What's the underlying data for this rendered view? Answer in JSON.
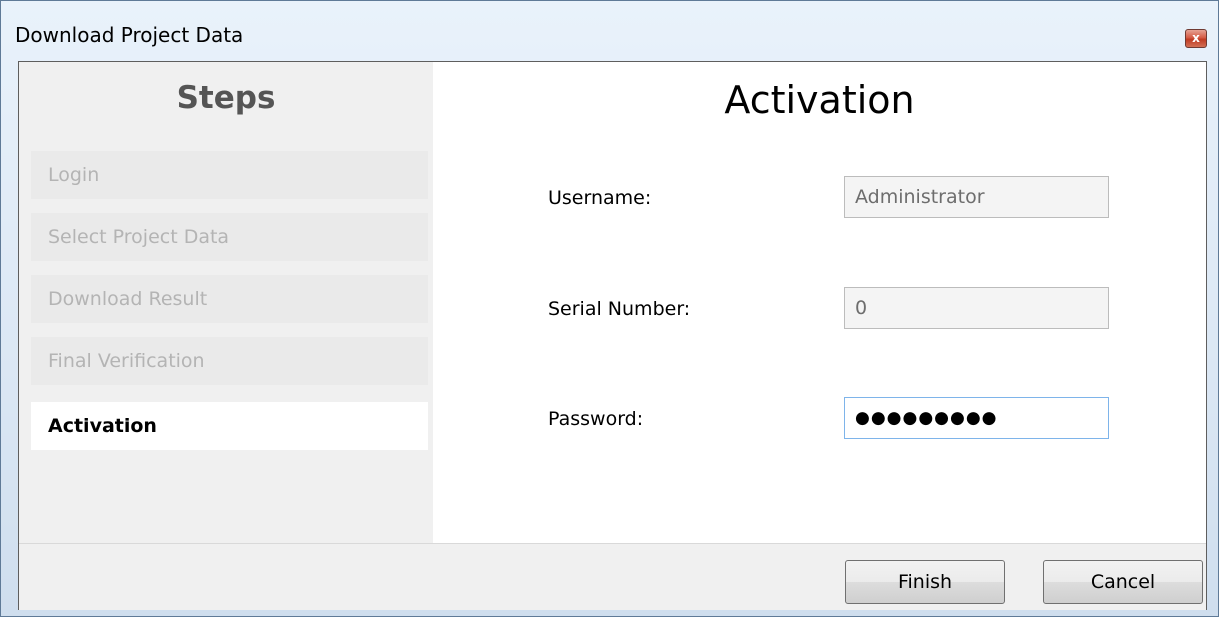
{
  "window": {
    "title": "Download Project Data",
    "close_glyph": "x"
  },
  "sidebar": {
    "title": "Steps",
    "items": [
      {
        "label": "Login",
        "state": "inactive"
      },
      {
        "label": "Select Project Data",
        "state": "inactive"
      },
      {
        "label": "Download Result",
        "state": "inactive"
      },
      {
        "label": "Final Verification",
        "state": "inactive"
      },
      {
        "label": "Activation",
        "state": "active"
      }
    ]
  },
  "main": {
    "title": "Activation",
    "fields": {
      "username": {
        "label": "Username:",
        "value": "Administrator"
      },
      "serial": {
        "label": "Serial Number:",
        "value": "0"
      },
      "password": {
        "label": "Password:",
        "value": "●●●●●●●●●"
      }
    }
  },
  "footer": {
    "finish_label": "Finish",
    "cancel_label": "Cancel"
  },
  "colors": {
    "title_bar": "#dbe7f4",
    "close_button": "#c9452e",
    "active_input_border": "#7eb4ea",
    "inactive_step_text": "#b4b4b4"
  },
  "icons": {
    "close": "close-icon"
  }
}
